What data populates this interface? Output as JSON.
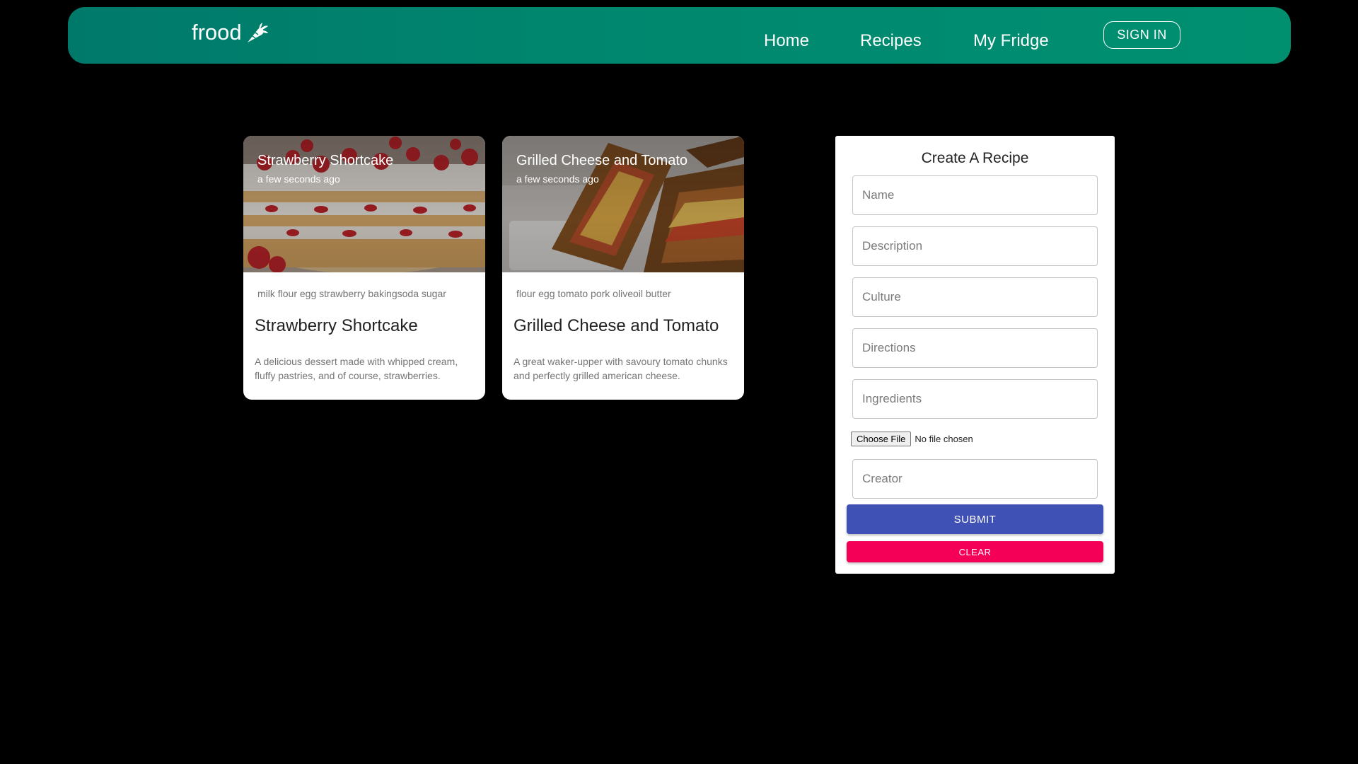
{
  "navbar": {
    "brand": "frood",
    "brand_icon": "carrot-icon",
    "links": [
      "Home",
      "Recipes",
      "My Fridge"
    ],
    "sign_in": "SIGN IN",
    "gradient": [
      "#00796b",
      "#009070"
    ]
  },
  "recipes": [
    {
      "title": "Strawberry Shortcake",
      "time": "a few seconds ago",
      "tags": "milk flour egg strawberry bakingsoda sugar",
      "description": "A delicious dessert made with whipped cream, fluffy pastries, and of course, strawberries."
    },
    {
      "title": "Grilled Cheese and Tomato",
      "time": "a few seconds ago",
      "tags": "flour egg tomato pork oliveoil butter",
      "description": "A great waker-upper with savoury tomato chunks and perfectly grilled american cheese."
    }
  ],
  "form": {
    "title": "Create A Recipe",
    "placeholders": {
      "name": "Name",
      "description": "Description",
      "culture": "Culture",
      "directions": "Directions",
      "ingredients": "Ingredients",
      "creator": "Creator"
    },
    "file_button": "Choose File",
    "file_status": "No file chosen",
    "submit": "SUBMIT",
    "clear": "CLEAR"
  },
  "colors": {
    "background": "#000000",
    "submit": "#3f51b5",
    "clear": "#f50057"
  }
}
